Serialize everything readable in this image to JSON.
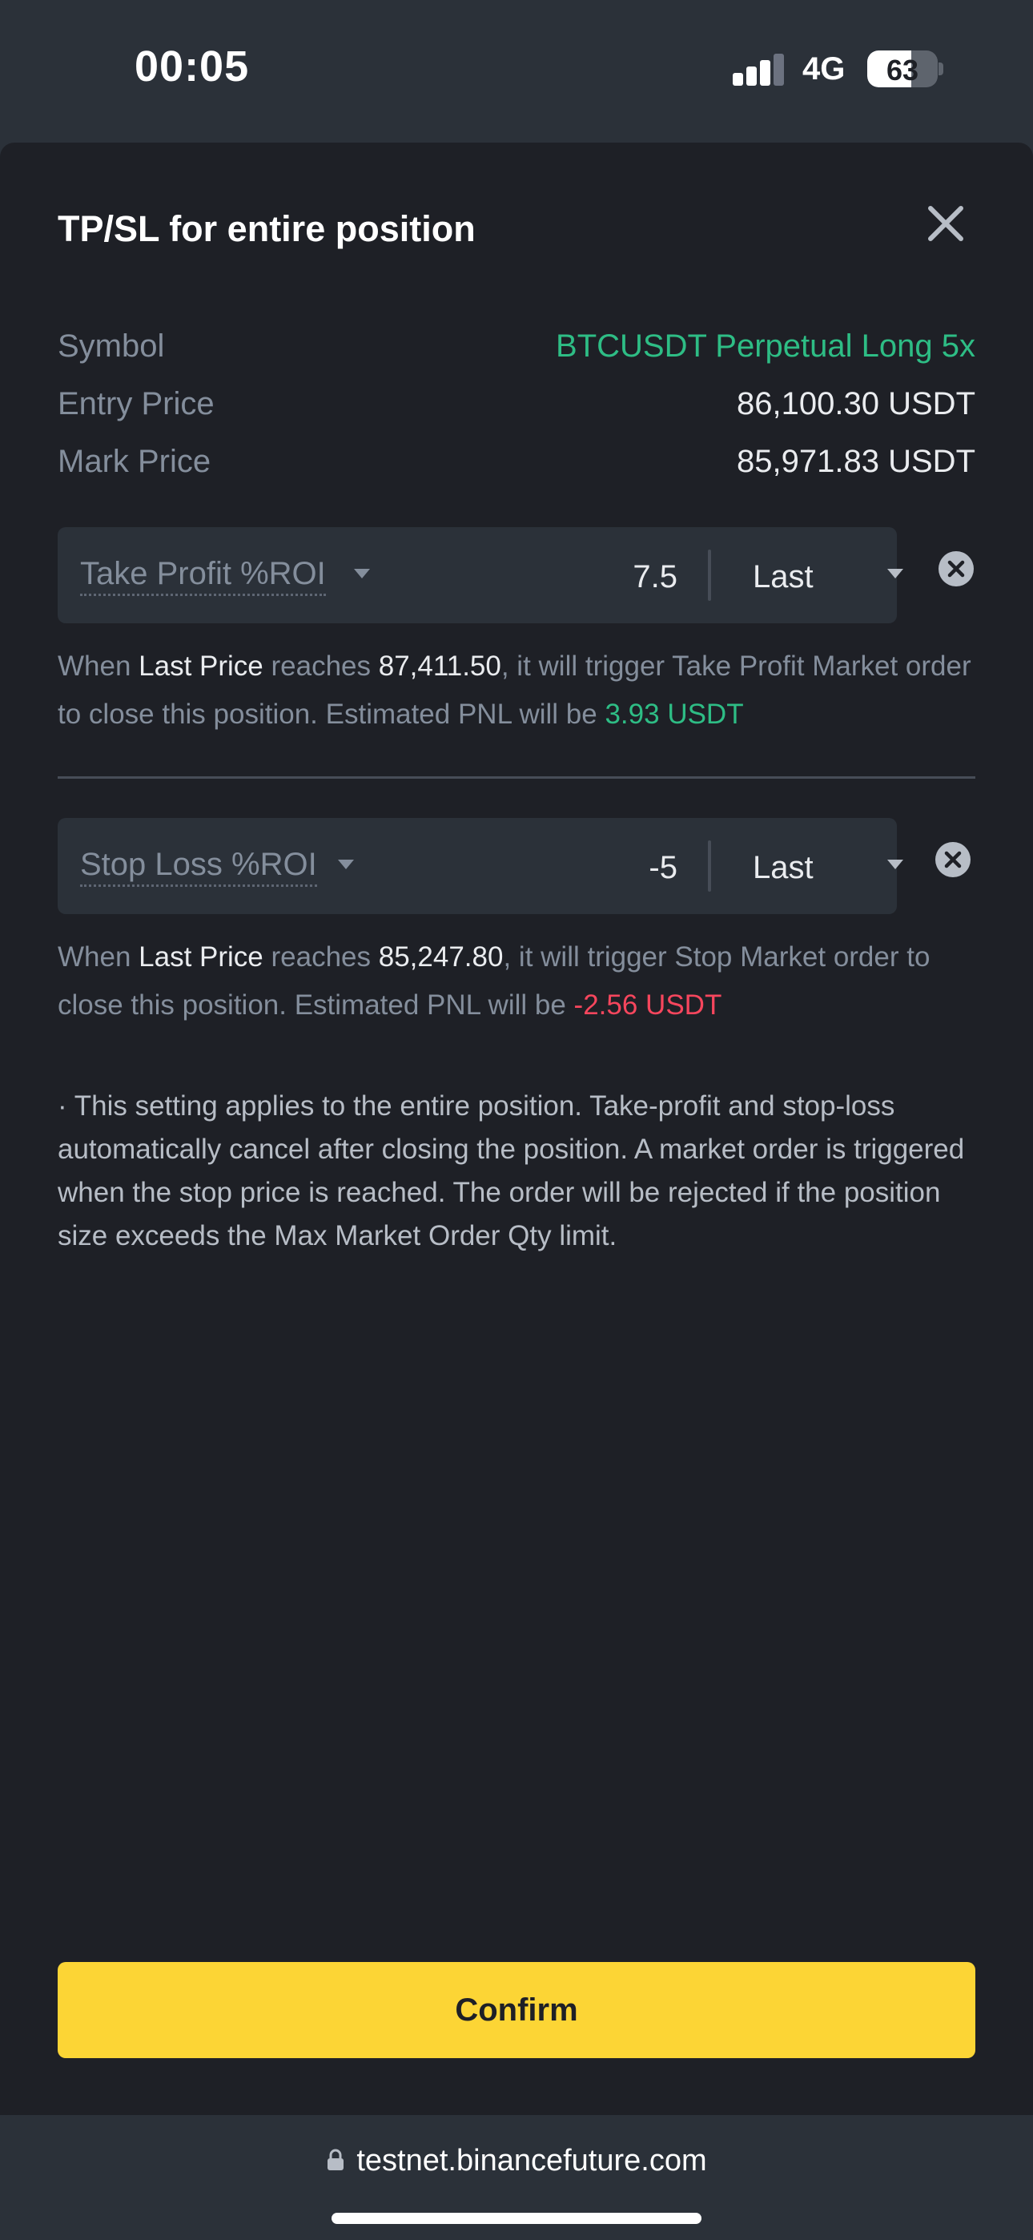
{
  "status": {
    "time": "00:05",
    "network": "4G",
    "battery_level": "63",
    "battery_fraction": 0.63
  },
  "sheet": {
    "title": "TP/SL for entire position",
    "info": [
      {
        "label": "Symbol",
        "value": "BTCUSDT Perpetual Long 5x"
      },
      {
        "label": "Entry Price",
        "value": "86,100.30 USDT"
      },
      {
        "label": "Mark Price",
        "value": "85,971.83 USDT"
      }
    ],
    "take_profit": {
      "label": "Take Profit %ROI",
      "value": "7.5",
      "price_type": "Last",
      "desc": {
        "p1": "When ",
        "price_type": "Last Price",
        "p2": " reaches ",
        "price": "87,411.50",
        "p3": ", it will trigger Take Profit Market order to close this position. Estimated PNL will be ",
        "pnl": "3.93 USDT"
      }
    },
    "stop_loss": {
      "label": "Stop Loss %ROI",
      "value": "-5",
      "price_type": "Last",
      "desc": {
        "p1": "When ",
        "price_type": "Last Price",
        "p2": " reaches ",
        "price": "85,247.80",
        "p3": ", it will trigger Stop Market order to close this position. Estimated PNL will be ",
        "pnl": "-2.56 USDT"
      }
    },
    "note": "· This setting applies to the entire position. Take-profit and stop-loss automatically cancel after closing the position. A market order is triggered when the stop price is reached. The order will be rejected if the position size exceeds the Max Market Order Qty limit.",
    "confirm_label": "Confirm"
  },
  "browser": {
    "url": "testnet.binancefuture.com"
  },
  "colors": {
    "accent": "#fcd535",
    "profit": "#2ebd85",
    "loss": "#f6465d",
    "sheet_bg": "#1e2026",
    "field_bg": "#2b3139"
  },
  "icons": [
    "signal-icon",
    "battery-icon",
    "close-icon",
    "clear-icon",
    "caret-down-icon",
    "lock-icon"
  ]
}
